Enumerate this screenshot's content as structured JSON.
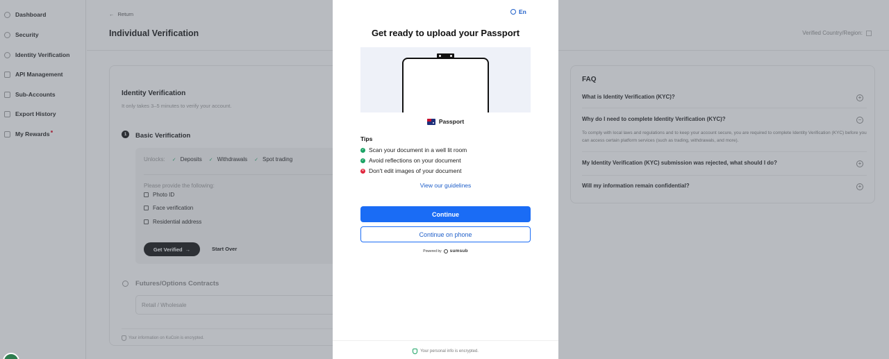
{
  "sidebar": {
    "items": [
      {
        "label": "Dashboard",
        "icon": "dashboard-icon"
      },
      {
        "label": "Security",
        "icon": "shield-icon"
      },
      {
        "label": "Identity Verification",
        "icon": "user-icon"
      },
      {
        "label": "API Management",
        "icon": "api-icon"
      },
      {
        "label": "Sub-Accounts",
        "icon": "accounts-icon"
      },
      {
        "label": "Export History",
        "icon": "export-icon"
      },
      {
        "label": "My Rewards",
        "icon": "gift-icon"
      }
    ]
  },
  "header": {
    "return_label": "Return",
    "page_title": "Individual Verification",
    "verified_country_label": "Verified Country/Region:"
  },
  "identity": {
    "title": "Identity Verification",
    "subtitle": "It only takes 3–5 minutes to verify your account.",
    "step_number": "1",
    "step_title": "Basic Verification",
    "unlocks_label": "Unlocks:",
    "unlocks": [
      "Deposits",
      "Withdrawals",
      "Spot trading"
    ],
    "provide_label": "Please provide the following:",
    "requirements": [
      "Photo ID",
      "Face verification",
      "Residential address"
    ],
    "get_verified_label": "Get Verified",
    "start_over_label": "Start Over",
    "futures_title": "Futures/Options Contracts",
    "retail_placeholder": "Retail / Wholesale",
    "encrypted_note": "Your information on KuCoin is encrypted."
  },
  "faq": {
    "title": "FAQ",
    "items": [
      {
        "question": "What is Identity Verification (KYC)?",
        "toggle": "+"
      },
      {
        "question": "Why do I need to complete Identity Verification (KYC)?",
        "toggle": "−"
      },
      {
        "question": "My Identity Verification (KYC) submission was rejected, what should I do?",
        "toggle": "+"
      },
      {
        "question": "Will my information remain confidential?",
        "toggle": "+"
      }
    ],
    "answer": "To comply with local laws and regulations and to keep your account secure, you are required to complete Identity Verification (KYC) before you can access certain platform services (such as trading, withdrawals, and more)."
  },
  "modal": {
    "language": "En",
    "title": "Get ready to upload your Passport",
    "document_label": "Passport",
    "tips_title": "Tips",
    "tips": [
      {
        "text": "Scan your document in a well lit room",
        "status": "ok"
      },
      {
        "text": "Avoid reflections on your document",
        "status": "ok"
      },
      {
        "text": "Don't edit images of your document",
        "status": "bad"
      }
    ],
    "guidelines_label": "View our guidelines",
    "continue_label": "Continue",
    "continue_phone_label": "Continue on phone",
    "powered_by": "Powered by",
    "powered_brand": "sumsub",
    "encrypted_note": "Your personal info is encrypted."
  },
  "colors": {
    "accent_blue": "#1a6cf5",
    "success_green": "#1aa364",
    "error_red": "#e0243b",
    "overlay": "#555c68"
  }
}
